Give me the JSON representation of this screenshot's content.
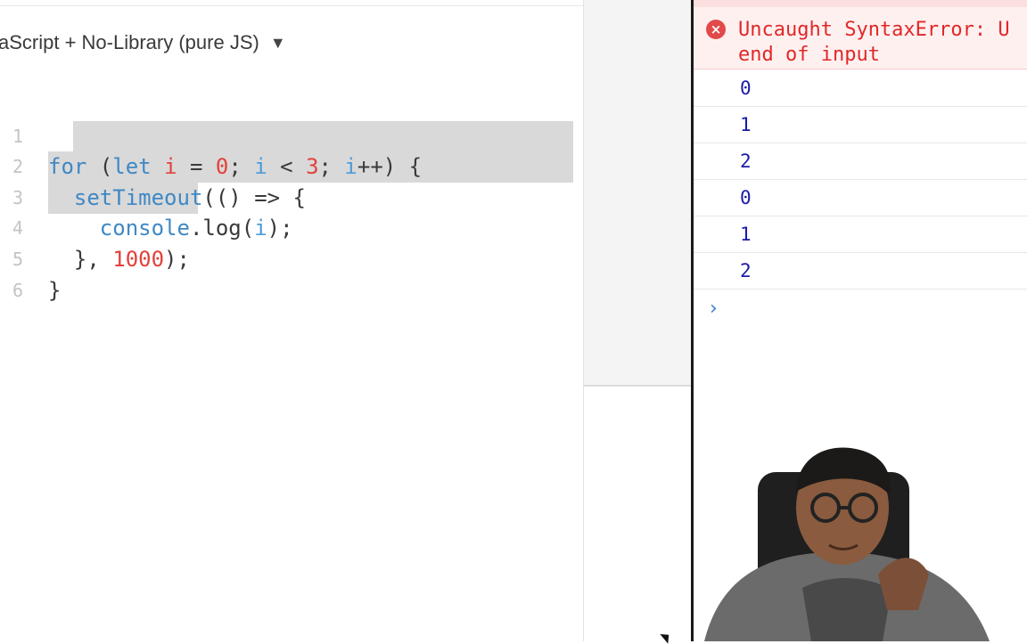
{
  "editor": {
    "language_label": "aScript + No-Library (pure JS)",
    "language_caret": "▼",
    "line_numbers": [
      "1",
      "2",
      "3",
      "4",
      "5",
      "6"
    ]
  },
  "console": {
    "error_message": "Uncaught SyntaxError: U\nend of input",
    "error_icon": "x-circle-icon",
    "log_values": [
      "0",
      "1",
      "2",
      "0",
      "1",
      "2"
    ],
    "prompt_symbol": "›"
  },
  "colors": {
    "keyword": "#3f88c5",
    "number": "#e3413c",
    "error": "#e02828",
    "log_value": "#1a1aa8"
  }
}
